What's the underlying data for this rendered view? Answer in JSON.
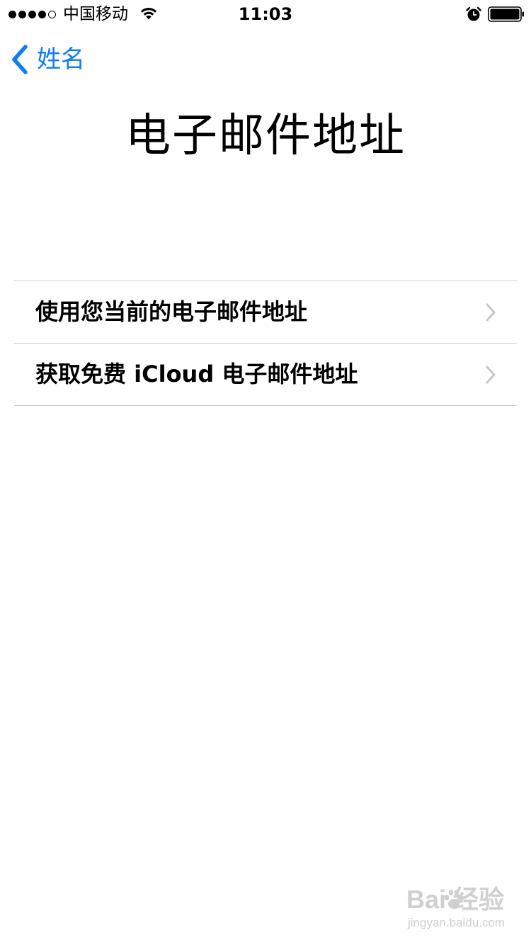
{
  "status_bar": {
    "carrier": "中国移动",
    "time": "11:03",
    "signal_total": 5,
    "signal_filled": 4,
    "icons": [
      "wifi-icon",
      "alarm-icon",
      "battery-icon"
    ]
  },
  "nav": {
    "back_label": "姓名",
    "back_icon": "chevron-left-icon"
  },
  "page": {
    "title": "电子邮件地址"
  },
  "options": [
    {
      "label": "使用您当前的电子邮件地址",
      "icon": "chevron-right-icon"
    },
    {
      "label": "获取免费 iCloud 电子邮件地址",
      "icon": "chevron-right-icon"
    }
  ],
  "watermark": {
    "logo": "Bai  经验",
    "sub": "jingyan.baidu.com"
  },
  "colors": {
    "accent": "#0f7cf6",
    "text": "#000000",
    "divider": "#cfcfd3",
    "chevron": "#c7c7cc",
    "background": "#ffffff"
  }
}
